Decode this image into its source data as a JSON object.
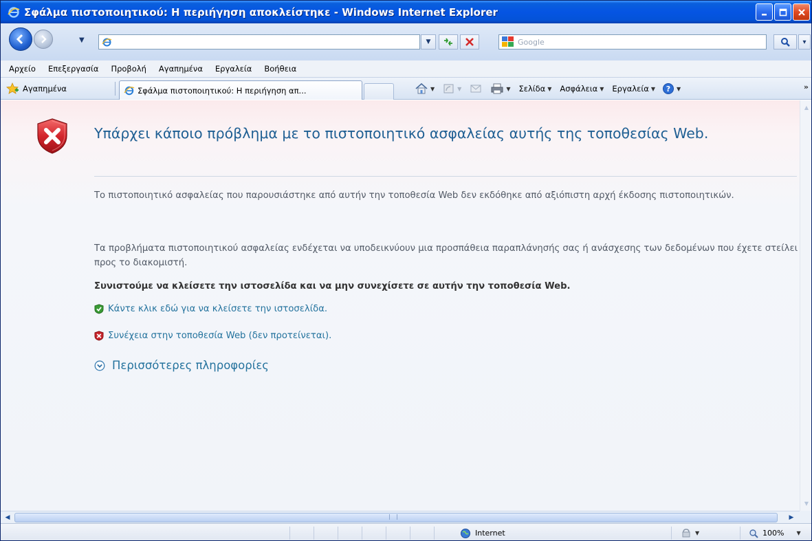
{
  "window": {
    "title": "Σφάλμα πιστοποιητικού: Η περιήγηση αποκλείστηκε - Windows Internet Explorer"
  },
  "address": {
    "url": "",
    "search_placeholder": "Google"
  },
  "menu": {
    "items": [
      "Αρχείο",
      "Επεξεργασία",
      "Προβολή",
      "Αγαπημένα",
      "Εργαλεία",
      "Βοήθεια"
    ]
  },
  "favorites": {
    "label": "Αγαπημένα"
  },
  "tab": {
    "title": "Σφάλμα πιστοποιητικού: Η περιήγηση απ..."
  },
  "commandbar": {
    "page_label": "Σελίδα",
    "safety_label": "Ασφάλεια",
    "tools_label": "Εργαλεία"
  },
  "content": {
    "headline": "Υπάρχει κάποιο πρόβλημα με το πιστοποιητικό ασφαλείας αυτής της τοποθεσίας Web.",
    "paragraph1": "Το πιστοποιητικό ασφαλείας που παρουσιάστηκε από αυτήν την τοποθεσία Web δεν εκδόθηκε από αξιόπιστη αρχή έκδοσης πιστοποιητικών.",
    "paragraph2": "Τα προβλήματα πιστοποιητικού ασφαλείας ενδέχεται να υποδεικνύουν μια προσπάθεια παραπλάνησής σας ή ανάσχεσης των δεδομένων που έχετε στείλει προς το διακομιστή.",
    "recommendation": "Συνιστούμε να κλείσετε την ιστοσελίδα και να μην συνεχίσετε σε αυτήν την τοποθεσία Web.",
    "close_link": "Κάντε κλικ εδώ για να κλείσετε την ιστοσελίδα.",
    "continue_link": "Συνέχεια στην τοποθεσία Web (δεν προτείνεται).",
    "more_info": "Περισσότερες πληροφορίες"
  },
  "status": {
    "zone": "Internet",
    "zoom": "100%"
  },
  "colors": {
    "headline": "#1f5f93",
    "link": "#24739e",
    "error_red": "#c8252c",
    "safe_green": "#3a9b35"
  }
}
